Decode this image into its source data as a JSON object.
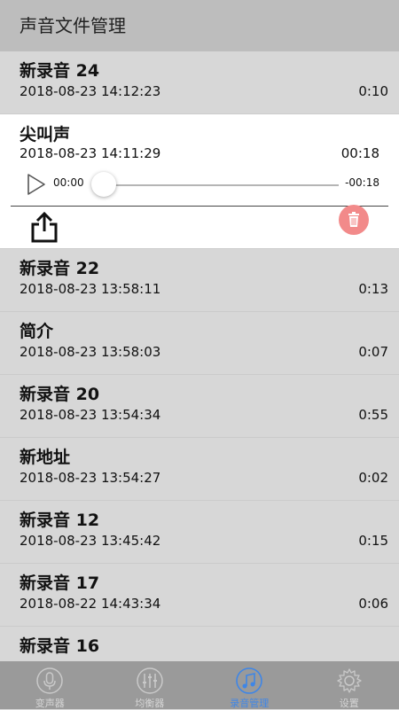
{
  "header": {
    "title": "声音文件管理"
  },
  "expanded": {
    "name": "尖叫声",
    "date": "2018-08-23 14:11:29",
    "duration": "00:18",
    "player": {
      "current": "00:00",
      "remaining": "-00:18",
      "progress": 0
    }
  },
  "recordings": [
    {
      "name": "新录音 24",
      "date": "2018-08-23 14:12:23",
      "duration": "0:10"
    },
    {
      "name": "新录音 22",
      "date": "2018-08-23 13:58:11",
      "duration": "0:13"
    },
    {
      "name": "简介",
      "date": "2018-08-23 13:58:03",
      "duration": "0:07"
    },
    {
      "name": "新录音 20",
      "date": "2018-08-23 13:54:34",
      "duration": "0:55"
    },
    {
      "name": "新地址",
      "date": "2018-08-23 13:54:27",
      "duration": "0:02"
    },
    {
      "name": "新录音 12",
      "date": "2018-08-23 13:45:42",
      "duration": "0:15"
    },
    {
      "name": "新录音 17",
      "date": "2018-08-22 14:43:34",
      "duration": "0:06"
    },
    {
      "name": "新录音 16",
      "date": "",
      "duration": ""
    }
  ],
  "tabs": [
    {
      "label": "变声器",
      "icon": "microphone-icon"
    },
    {
      "label": "均衡器",
      "icon": "equalizer-icon"
    },
    {
      "label": "录音管理",
      "icon": "music-note-icon",
      "active": true
    },
    {
      "label": "设置",
      "icon": "gear-icon"
    }
  ],
  "colors": {
    "accent": "#3f86e6",
    "delete": "#f28a8a",
    "tabbar": "#9a9a9a",
    "header": "#bdbdbd"
  }
}
